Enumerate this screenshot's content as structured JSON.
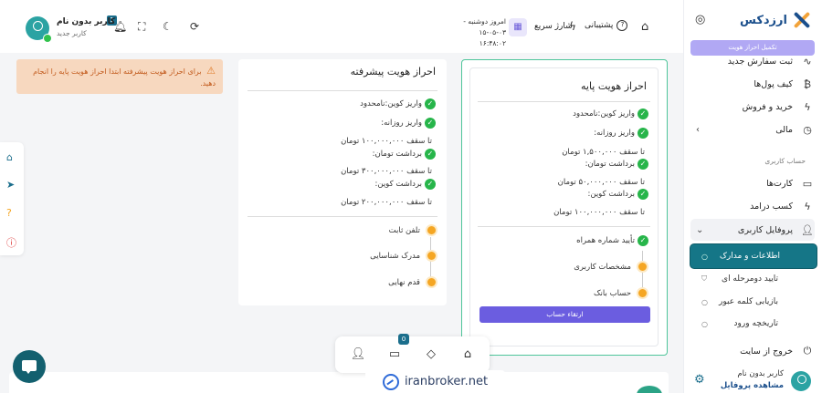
{
  "brand": {
    "name": "ارزدکس"
  },
  "sidebar": {
    "upgrade_chip": "تکمیل احراز هویت",
    "items": [
      {
        "label": "ثبت سفارش جدید",
        "icon": "chart-icon"
      },
      {
        "label": "کیف پول‌ها",
        "icon": "bitcoin-icon"
      },
      {
        "label": "خرید و فروش",
        "icon": "bolt-icon"
      },
      {
        "label": "مالی",
        "icon": "clock-icon"
      }
    ],
    "section_label": "حساب کاربری",
    "account_items": [
      {
        "label": "کارت‌ها",
        "icon": "card-icon"
      },
      {
        "label": "کسب درامد",
        "icon": "bolt-icon"
      },
      {
        "label": "پروفایل کاربری",
        "icon": "user-icon"
      }
    ],
    "sub_items": [
      {
        "label": "اطلاعات و مدارک"
      },
      {
        "label": "تایید دومرحله ای"
      },
      {
        "label": "بازیابی کلمه عبور"
      },
      {
        "label": "تاریخچه ورود"
      }
    ],
    "logout": "خروج از سایت",
    "profile": {
      "name": "کاربر بدون نام",
      "link": "مشاهده پروفایل"
    }
  },
  "header": {
    "support": "پشتیبانی",
    "quick_charge": "شارژ سریع",
    "date_line1": "امروز دوشنبه - ۰۳-۰۵-۱۵",
    "date_line2": "۱۶:۴۸:۰۲",
    "notification_count": "1",
    "user_name": "کاربر بدون نام",
    "user_role": "کاربر جدید"
  },
  "warning": {
    "text": "برای احراز هویت پیشرفته ابتدا احراز هویت پایه را انجام دهید."
  },
  "advanced": {
    "title": "احراز هویت پیشرفته",
    "features": [
      "واریز کوین:نامحدود",
      "واریز روزانه:",
      "تا سقف ۱۰۰,۰۰۰,۰۰۰ تومان",
      "برداشت تومان:",
      "تا سقف ۳۰۰,۰۰۰,۰۰۰ تومان",
      "برداشت کوین:",
      "تا سقف ۲۰۰,۰۰۰,۰۰۰ تومان"
    ],
    "steps": [
      "تلفن ثابت",
      "مدرک شناسایی",
      "قدم نهایی"
    ]
  },
  "basic": {
    "title": "احراز هویت پایه",
    "features": [
      "واریز کوین:نامحدود",
      "واریز روزانه:",
      "تا سقف ۱,۵۰۰,۰۰۰ تومان",
      "برداشت تومان:",
      "تا سقف ۵۰,۰۰۰,۰۰۰ تومان",
      "برداشت کوین:",
      "تا سقف ۱۰۰,۰۰۰,۰۰۰ تومان"
    ],
    "steps": [
      "تأیید شماره همراه",
      "مشخصات کاربری",
      "حساب بانک"
    ],
    "upgrade_button": "ارتقاء حساب"
  },
  "bottom_nav": {
    "badge": "0"
  },
  "watermark": {
    "text": "iranbroker.net"
  },
  "colors": {
    "accent": "#157687",
    "brand": "#1b4f8c",
    "success": "#27b54a",
    "pending": "#f5a623",
    "button": "#6b5de0",
    "warning_bg": "#f7d8bf"
  }
}
